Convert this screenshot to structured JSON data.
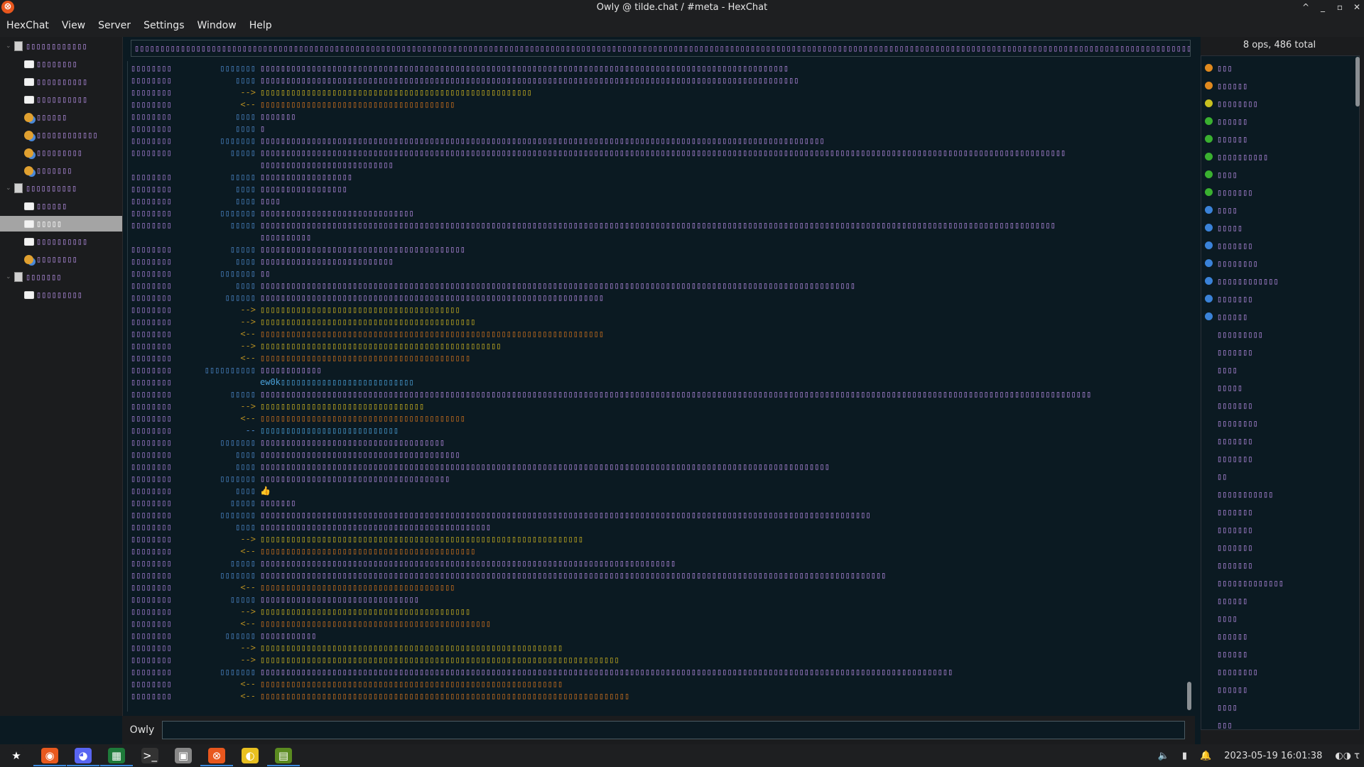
{
  "window": {
    "title": "Owly @ tilde.chat / #meta - HexChat",
    "controls": [
      "^",
      "_",
      "▫",
      "✕"
    ]
  },
  "menu": [
    "HexChat",
    "View",
    "Server",
    "Settings",
    "Window",
    "Help"
  ],
  "tree": [
    {
      "type": "server",
      "label": "▯▯▯▯▯▯▯▯▯▯▯▯"
    },
    {
      "type": "chat",
      "label": "▯▯▯▯▯▯▯▯"
    },
    {
      "type": "chat",
      "label": "▯▯▯▯▯▯▯▯▯▯"
    },
    {
      "type": "chat",
      "label": "▯▯▯▯▯▯▯▯▯▯"
    },
    {
      "type": "users",
      "label": "▯▯▯▯▯▯"
    },
    {
      "type": "users",
      "label": "▯▯▯▯▯▯▯▯▯▯▯▯"
    },
    {
      "type": "users",
      "label": "▯▯▯▯▯▯▯▯▯"
    },
    {
      "type": "users",
      "label": "▯▯▯▯▯▯▯"
    },
    {
      "type": "server",
      "label": "▯▯▯▯▯▯▯▯▯▯"
    },
    {
      "type": "chat",
      "label": "▯▯▯▯▯▯"
    },
    {
      "type": "chat",
      "label": "▯▯▯▯▯",
      "selected": true
    },
    {
      "type": "chat",
      "label": "▯▯▯▯▯▯▯▯▯▯"
    },
    {
      "type": "users",
      "label": "▯▯▯▯▯▯▯▯"
    },
    {
      "type": "server",
      "label": "▯▯▯▯▯▯▯"
    },
    {
      "type": "chat",
      "label": "▯▯▯▯▯▯▯▯▯"
    }
  ],
  "topic": "▯▯▯▯▯▯▯▯▯▯▯▯▯▯▯▯▯▯▯▯▯▯▯▯▯▯▯▯▯▯▯▯▯▯▯▯▯▯▯▯▯▯▯▯▯▯▯▯▯▯▯▯▯▯▯▯▯▯▯▯▯▯▯▯▯▯▯▯▯▯▯▯▯▯▯▯▯▯▯▯▯▯▯▯▯▯▯▯▯▯▯▯▯▯▯▯▯▯▯▯▯▯▯▯▯▯▯▯▯▯▯▯▯▯▯▯▯▯▯▯▯▯▯▯▯▯▯▯▯▯▯▯▯▯▯▯▯▯▯▯▯▯▯▯▯▯▯▯▯▯▯▯▯▯▯▯▯▯▯▯▯▯▯▯▯▯▯▯▯▯▯▯▯▯▯▯▯▯▯▯▯▯▯▯▯▯▯▯▯▯▯▯▯▯▯▯▯▯▯▯▯▯▯▯▯▯▯",
  "chat_lines": [
    {
      "ts": "▯▯▯▯▯▯▯▯",
      "nick": "▯▯▯▯▯▯▯",
      "kind": "msg",
      "text": "▯▯▯▯▯▯▯▯▯▯▯▯▯▯▯▯▯▯▯▯▯▯▯▯▯▯▯▯▯▯▯▯▯▯▯▯▯▯▯▯▯▯▯▯▯▯▯▯▯▯▯▯▯▯▯▯▯▯▯▯▯▯▯▯▯▯▯▯▯▯▯▯▯▯▯▯▯▯▯▯▯▯▯▯▯▯▯▯▯▯▯▯▯▯▯▯▯▯▯▯▯▯▯"
    },
    {
      "ts": "▯▯▯▯▯▯▯▯",
      "nick": "▯▯▯▯",
      "kind": "msg",
      "text": "▯▯▯▯▯▯▯▯▯▯▯▯▯▯▯▯▯▯▯▯▯▯▯▯▯▯▯▯▯▯▯▯▯▯▯▯▯▯▯▯▯▯▯▯▯▯▯▯▯▯▯▯▯▯▯▯▯▯▯▯▯▯▯▯▯▯▯▯▯▯▯▯▯▯▯▯▯▯▯▯▯▯▯▯▯▯▯▯▯▯▯▯▯▯▯▯▯▯▯▯▯▯▯▯▯"
    },
    {
      "ts": "▯▯▯▯▯▯▯▯",
      "nick": "-->",
      "kind": "join",
      "text": "▯▯▯▯▯▯▯▯▯▯▯▯▯▯▯▯▯▯▯▯▯▯▯▯▯▯▯▯▯▯▯▯▯▯▯▯▯▯▯▯▯▯▯▯▯▯▯▯▯▯▯▯▯"
    },
    {
      "ts": "▯▯▯▯▯▯▯▯",
      "nick": "<--",
      "kind": "part",
      "text": "▯▯▯▯▯▯▯▯▯▯▯▯▯▯▯▯▯▯▯▯▯▯▯▯▯▯▯▯▯▯▯▯▯▯▯▯▯▯"
    },
    {
      "ts": "▯▯▯▯▯▯▯▯",
      "nick": "▯▯▯▯",
      "kind": "msg",
      "text": "▯▯▯▯▯▯▯"
    },
    {
      "ts": "▯▯▯▯▯▯▯▯",
      "nick": "▯▯▯▯",
      "kind": "msg",
      "text": "▯"
    },
    {
      "ts": "▯▯▯▯▯▯▯▯",
      "nick": "▯▯▯▯▯▯▯",
      "kind": "msg",
      "text": "▯▯▯▯▯▯▯▯▯▯▯▯▯▯▯▯▯▯▯▯▯▯▯▯▯▯▯▯▯▯▯▯▯▯▯▯▯▯▯▯▯▯▯▯▯▯▯▯▯▯▯▯▯▯▯▯▯▯▯▯▯▯▯▯▯▯▯▯▯▯▯▯▯▯▯▯▯▯▯▯▯▯▯▯▯▯▯▯▯▯▯▯▯▯▯▯▯▯▯▯▯▯▯▯▯▯▯▯▯▯"
    },
    {
      "ts": "▯▯▯▯▯▯▯▯",
      "nick": "▯▯▯▯▯",
      "kind": "msg",
      "text": "▯▯▯▯▯▯▯▯▯▯▯▯▯▯▯▯▯▯▯▯▯▯▯▯▯▯▯▯▯▯▯▯▯▯▯▯▯▯▯▯▯▯▯▯▯▯▯▯▯▯▯▯▯▯▯▯▯▯▯▯▯▯▯▯▯▯▯▯▯▯▯▯▯▯▯▯▯▯▯▯▯▯▯▯▯▯▯▯▯▯▯▯▯▯▯▯▯▯▯▯▯▯▯▯▯▯▯▯▯▯▯▯▯▯▯▯▯▯▯▯▯▯▯▯▯▯▯▯▯▯▯▯▯▯▯▯▯▯▯▯▯▯▯▯▯▯▯▯▯▯▯▯▯▯▯▯▯"
    },
    {
      "ts": "",
      "nick": "",
      "kind": "msg",
      "text": "▯▯▯▯▯▯▯▯▯▯▯▯▯▯▯▯▯▯▯▯▯▯▯▯▯▯"
    },
    {
      "ts": "▯▯▯▯▯▯▯▯",
      "nick": "▯▯▯▯▯",
      "kind": "msg",
      "text": "▯▯▯▯▯▯▯▯▯▯▯▯▯▯▯▯▯▯"
    },
    {
      "ts": "▯▯▯▯▯▯▯▯",
      "nick": "▯▯▯▯",
      "kind": "msg",
      "text": "▯▯▯▯▯▯▯▯▯▯▯▯▯▯▯▯▯"
    },
    {
      "ts": "▯▯▯▯▯▯▯▯",
      "nick": "▯▯▯▯",
      "kind": "msg",
      "text": "▯▯▯▯"
    },
    {
      "ts": "▯▯▯▯▯▯▯▯",
      "nick": "▯▯▯▯▯▯▯",
      "kind": "msg",
      "text": "▯▯▯▯▯▯▯▯▯▯▯▯▯▯▯▯▯▯▯▯▯▯▯▯▯▯▯▯▯▯"
    },
    {
      "ts": "▯▯▯▯▯▯▯▯",
      "nick": "▯▯▯▯▯",
      "kind": "msg",
      "text": "▯▯▯▯▯▯▯▯▯▯▯▯▯▯▯▯▯▯▯▯▯▯▯▯▯▯▯▯▯▯▯▯▯▯▯▯▯▯▯▯▯▯▯▯▯▯▯▯▯▯▯▯▯▯▯▯▯▯▯▯▯▯▯▯▯▯▯▯▯▯▯▯▯▯▯▯▯▯▯▯▯▯▯▯▯▯▯▯▯▯▯▯▯▯▯▯▯▯▯▯▯▯▯▯▯▯▯▯▯▯▯▯▯▯▯▯▯▯▯▯▯▯▯▯▯▯▯▯▯▯▯▯▯▯▯▯▯▯▯▯▯▯▯▯▯▯▯▯▯▯▯▯▯▯▯"
    },
    {
      "ts": "",
      "nick": "",
      "kind": "msg",
      "text": "▯▯▯▯▯▯▯▯▯▯"
    },
    {
      "ts": "▯▯▯▯▯▯▯▯",
      "nick": "▯▯▯▯▯",
      "kind": "msg",
      "text": "▯▯▯▯▯▯▯▯▯▯▯▯▯▯▯▯▯▯▯▯▯▯▯▯▯▯▯▯▯▯▯▯▯▯▯▯▯▯▯▯"
    },
    {
      "ts": "▯▯▯▯▯▯▯▯",
      "nick": "▯▯▯▯",
      "kind": "msg",
      "text": "▯▯▯▯▯▯▯▯▯▯▯▯▯▯▯▯▯▯▯▯▯▯▯▯▯▯"
    },
    {
      "ts": "▯▯▯▯▯▯▯▯",
      "nick": "▯▯▯▯▯▯▯",
      "kind": "msg",
      "text": "▯▯"
    },
    {
      "ts": "▯▯▯▯▯▯▯▯",
      "nick": "▯▯▯▯",
      "kind": "msg",
      "text": "▯▯▯▯▯▯▯▯▯▯▯▯▯▯▯▯▯▯▯▯▯▯▯▯▯▯▯▯▯▯▯▯▯▯▯▯▯▯▯▯▯▯▯▯▯▯▯▯▯▯▯▯▯▯▯▯▯▯▯▯▯▯▯▯▯▯▯▯▯▯▯▯▯▯▯▯▯▯▯▯▯▯▯▯▯▯▯▯▯▯▯▯▯▯▯▯▯▯▯▯▯▯▯▯▯▯▯▯▯▯▯▯▯▯▯▯"
    },
    {
      "ts": "▯▯▯▯▯▯▯▯",
      "nick": "▯▯▯▯▯▯",
      "kind": "msg",
      "text": "▯▯▯▯▯▯▯▯▯▯▯▯▯▯▯▯▯▯▯▯▯▯▯▯▯▯▯▯▯▯▯▯▯▯▯▯▯▯▯▯▯▯▯▯▯▯▯▯▯▯▯▯▯▯▯▯▯▯▯▯▯▯▯▯▯▯▯"
    },
    {
      "ts": "▯▯▯▯▯▯▯▯",
      "nick": "-->",
      "kind": "join",
      "text": "▯▯▯▯▯▯▯▯▯▯▯▯▯▯▯▯▯▯▯▯▯▯▯▯▯▯▯▯▯▯▯▯▯▯▯▯▯▯▯"
    },
    {
      "ts": "▯▯▯▯▯▯▯▯",
      "nick": "-->",
      "kind": "join",
      "text": "▯▯▯▯▯▯▯▯▯▯▯▯▯▯▯▯▯▯▯▯▯▯▯▯▯▯▯▯▯▯▯▯▯▯▯▯▯▯▯▯▯▯"
    },
    {
      "ts": "▯▯▯▯▯▯▯▯",
      "nick": "<--",
      "kind": "part",
      "text": "▯▯▯▯▯▯▯▯▯▯▯▯▯▯▯▯▯▯▯▯▯▯▯▯▯▯▯▯▯▯▯▯▯▯▯▯▯▯▯▯▯▯▯▯▯▯▯▯▯▯▯▯▯▯▯▯▯▯▯▯▯▯▯▯▯▯▯"
    },
    {
      "ts": "▯▯▯▯▯▯▯▯",
      "nick": "-->",
      "kind": "join",
      "text": "▯▯▯▯▯▯▯▯▯▯▯▯▯▯▯▯▯▯▯▯▯▯▯▯▯▯▯▯▯▯▯▯▯▯▯▯▯▯▯▯▯▯▯▯▯▯▯"
    },
    {
      "ts": "▯▯▯▯▯▯▯▯",
      "nick": "<--",
      "kind": "part",
      "text": "▯▯▯▯▯▯▯▯▯▯▯▯▯▯▯▯▯▯▯▯▯▯▯▯▯▯▯▯▯▯▯▯▯▯▯▯▯▯▯▯▯"
    },
    {
      "ts": "▯▯▯▯▯▯▯▯",
      "nick": "▯▯▯▯▯▯▯▯▯▯",
      "kind": "msg",
      "text": "▯▯▯▯▯▯▯▯▯▯▯▯"
    },
    {
      "ts": "▯▯▯▯▯▯▯▯",
      "nick": "",
      "kind": "mention",
      "text": "ew0k▯▯▯▯▯▯▯▯▯▯▯▯▯▯▯▯▯▯▯▯▯▯▯▯▯▯"
    },
    {
      "ts": "▯▯▯▯▯▯▯▯",
      "nick": "▯▯▯▯▯",
      "kind": "msg",
      "text": "▯▯▯▯▯▯▯▯▯▯▯▯▯▯▯▯▯▯▯▯▯▯▯▯▯▯▯▯▯▯▯▯▯▯▯▯▯▯▯▯▯▯▯▯▯▯▯▯▯▯▯▯▯▯▯▯▯▯▯▯▯▯▯▯▯▯▯▯▯▯▯▯▯▯▯▯▯▯▯▯▯▯▯▯▯▯▯▯▯▯▯▯▯▯▯▯▯▯▯▯▯▯▯▯▯▯▯▯▯▯▯▯▯▯▯▯▯▯▯▯▯▯▯▯▯▯▯▯▯▯▯▯▯▯▯▯▯▯▯▯▯▯▯▯▯▯▯▯▯▯▯▯▯▯▯▯▯▯▯▯▯▯"
    },
    {
      "ts": "▯▯▯▯▯▯▯▯",
      "nick": "-->",
      "kind": "join",
      "text": "▯▯▯▯▯▯▯▯▯▯▯▯▯▯▯▯▯▯▯▯▯▯▯▯▯▯▯▯▯▯▯▯"
    },
    {
      "ts": "▯▯▯▯▯▯▯▯",
      "nick": "<--",
      "kind": "part",
      "text": "▯▯▯▯▯▯▯▯▯▯▯▯▯▯▯▯▯▯▯▯▯▯▯▯▯▯▯▯▯▯▯▯▯▯▯▯▯▯▯▯"
    },
    {
      "ts": "▯▯▯▯▯▯▯▯",
      "nick": "--",
      "kind": "mention",
      "text": "▯▯▯▯▯▯▯▯▯▯▯▯▯▯▯▯▯▯▯▯▯▯▯▯▯▯▯"
    },
    {
      "ts": "▯▯▯▯▯▯▯▯",
      "nick": "▯▯▯▯▯▯▯",
      "kind": "msg",
      "text": "▯▯▯▯▯▯▯▯▯▯▯▯▯▯▯▯▯▯▯▯▯▯▯▯▯▯▯▯▯▯▯▯▯▯▯▯"
    },
    {
      "ts": "▯▯▯▯▯▯▯▯",
      "nick": "▯▯▯▯",
      "kind": "msg",
      "text": "▯▯▯▯▯▯▯▯▯▯▯▯▯▯▯▯▯▯▯▯▯▯▯▯▯▯▯▯▯▯▯▯▯▯▯▯▯▯▯"
    },
    {
      "ts": "▯▯▯▯▯▯▯▯",
      "nick": "▯▯▯▯",
      "kind": "msg",
      "text": "▯▯▯▯▯▯▯▯▯▯▯▯▯▯▯▯▯▯▯▯▯▯▯▯▯▯▯▯▯▯▯▯▯▯▯▯▯▯▯▯▯▯▯▯▯▯▯▯▯▯▯▯▯▯▯▯▯▯▯▯▯▯▯▯▯▯▯▯▯▯▯▯▯▯▯▯▯▯▯▯▯▯▯▯▯▯▯▯▯▯▯▯▯▯▯▯▯▯▯▯▯▯▯▯▯▯▯▯▯▯▯"
    },
    {
      "ts": "▯▯▯▯▯▯▯▯",
      "nick": "▯▯▯▯▯▯▯",
      "kind": "msg",
      "text": "▯▯▯▯▯▯▯▯▯▯▯▯▯▯▯▯▯▯▯▯▯▯▯▯▯▯▯▯▯▯▯▯▯▯▯▯▯"
    },
    {
      "ts": "▯▯▯▯▯▯▯▯",
      "nick": "▯▯▯▯",
      "kind": "msg",
      "text": "👍"
    },
    {
      "ts": "▯▯▯▯▯▯▯▯",
      "nick": "▯▯▯▯▯",
      "kind": "msg",
      "text": "▯▯▯▯▯▯▯"
    },
    {
      "ts": "▯▯▯▯▯▯▯▯",
      "nick": "▯▯▯▯▯▯▯",
      "kind": "msg",
      "text": "▯▯▯▯▯▯▯▯▯▯▯▯▯▯▯▯▯▯▯▯▯▯▯▯▯▯▯▯▯▯▯▯▯▯▯▯▯▯▯▯▯▯▯▯▯▯▯▯▯▯▯▯▯▯▯▯▯▯▯▯▯▯▯▯▯▯▯▯▯▯▯▯▯▯▯▯▯▯▯▯▯▯▯▯▯▯▯▯▯▯▯▯▯▯▯▯▯▯▯▯▯▯▯▯▯▯▯▯▯▯▯▯▯▯▯▯▯▯▯"
    },
    {
      "ts": "▯▯▯▯▯▯▯▯",
      "nick": "▯▯▯▯",
      "kind": "msg",
      "text": "▯▯▯▯▯▯▯▯▯▯▯▯▯▯▯▯▯▯▯▯▯▯▯▯▯▯▯▯▯▯▯▯▯▯▯▯▯▯▯▯▯▯▯▯▯"
    },
    {
      "ts": "▯▯▯▯▯▯▯▯",
      "nick": "-->",
      "kind": "join",
      "text": "▯▯▯▯▯▯▯▯▯▯▯▯▯▯▯▯▯▯▯▯▯▯▯▯▯▯▯▯▯▯▯▯▯▯▯▯▯▯▯▯▯▯▯▯▯▯▯▯▯▯▯▯▯▯▯▯▯▯▯▯▯▯▯"
    },
    {
      "ts": "▯▯▯▯▯▯▯▯",
      "nick": "<--",
      "kind": "part",
      "text": "▯▯▯▯▯▯▯▯▯▯▯▯▯▯▯▯▯▯▯▯▯▯▯▯▯▯▯▯▯▯▯▯▯▯▯▯▯▯▯▯▯▯"
    },
    {
      "ts": "▯▯▯▯▯▯▯▯",
      "nick": "▯▯▯▯▯",
      "kind": "msg",
      "text": "▯▯▯▯▯▯▯▯▯▯▯▯▯▯▯▯▯▯▯▯▯▯▯▯▯▯▯▯▯▯▯▯▯▯▯▯▯▯▯▯▯▯▯▯▯▯▯▯▯▯▯▯▯▯▯▯▯▯▯▯▯▯▯▯▯▯▯▯▯▯▯▯▯▯▯▯▯▯▯▯▯"
    },
    {
      "ts": "▯▯▯▯▯▯▯▯",
      "nick": "▯▯▯▯▯▯▯",
      "kind": "msg",
      "text": "▯▯▯▯▯▯▯▯▯▯▯▯▯▯▯▯▯▯▯▯▯▯▯▯▯▯▯▯▯▯▯▯▯▯▯▯▯▯▯▯▯▯▯▯▯▯▯▯▯▯▯▯▯▯▯▯▯▯▯▯▯▯▯▯▯▯▯▯▯▯▯▯▯▯▯▯▯▯▯▯▯▯▯▯▯▯▯▯▯▯▯▯▯▯▯▯▯▯▯▯▯▯▯▯▯▯▯▯▯▯▯▯▯▯▯▯▯▯▯▯▯▯"
    },
    {
      "ts": "▯▯▯▯▯▯▯▯",
      "nick": "<--",
      "kind": "part",
      "text": "▯▯▯▯▯▯▯▯▯▯▯▯▯▯▯▯▯▯▯▯▯▯▯▯▯▯▯▯▯▯▯▯▯▯▯▯▯▯"
    },
    {
      "ts": "▯▯▯▯▯▯▯▯",
      "nick": "▯▯▯▯▯",
      "kind": "msg",
      "text": "▯▯▯▯▯▯▯▯▯▯▯▯▯▯▯▯▯▯▯▯▯▯▯▯▯▯▯▯▯▯▯"
    },
    {
      "ts": "▯▯▯▯▯▯▯▯",
      "nick": "-->",
      "kind": "join",
      "text": "▯▯▯▯▯▯▯▯▯▯▯▯▯▯▯▯▯▯▯▯▯▯▯▯▯▯▯▯▯▯▯▯▯▯▯▯▯▯▯▯▯"
    },
    {
      "ts": "▯▯▯▯▯▯▯▯",
      "nick": "<--",
      "kind": "part",
      "text": "▯▯▯▯▯▯▯▯▯▯▯▯▯▯▯▯▯▯▯▯▯▯▯▯▯▯▯▯▯▯▯▯▯▯▯▯▯▯▯▯▯▯▯▯▯"
    },
    {
      "ts": "▯▯▯▯▯▯▯▯",
      "nick": "▯▯▯▯▯▯",
      "kind": "msg",
      "text": "▯▯▯▯▯▯▯▯▯▯▯"
    },
    {
      "ts": "▯▯▯▯▯▯▯▯",
      "nick": "-->",
      "kind": "join",
      "text": "▯▯▯▯▯▯▯▯▯▯▯▯▯▯▯▯▯▯▯▯▯▯▯▯▯▯▯▯▯▯▯▯▯▯▯▯▯▯▯▯▯▯▯▯▯▯▯▯▯▯▯▯▯▯▯▯▯▯▯"
    },
    {
      "ts": "▯▯▯▯▯▯▯▯",
      "nick": "-->",
      "kind": "join",
      "text": "▯▯▯▯▯▯▯▯▯▯▯▯▯▯▯▯▯▯▯▯▯▯▯▯▯▯▯▯▯▯▯▯▯▯▯▯▯▯▯▯▯▯▯▯▯▯▯▯▯▯▯▯▯▯▯▯▯▯▯▯▯▯▯▯▯▯▯▯▯▯"
    },
    {
      "ts": "▯▯▯▯▯▯▯▯",
      "nick": "▯▯▯▯▯▯▯",
      "kind": "msg",
      "text": "▯▯▯▯▯▯▯▯▯▯▯▯▯▯▯▯▯▯▯▯▯▯▯▯▯▯▯▯▯▯▯▯▯▯▯▯▯▯▯▯▯▯▯▯▯▯▯▯▯▯▯▯▯▯▯▯▯▯▯▯▯▯▯▯▯▯▯▯▯▯▯▯▯▯▯▯▯▯▯▯▯▯▯▯▯▯▯▯▯▯▯▯▯▯▯▯▯▯▯▯▯▯▯▯▯▯▯▯▯▯▯▯▯▯▯▯▯▯▯▯▯▯▯▯▯▯▯▯▯▯▯▯▯▯▯"
    },
    {
      "ts": "▯▯▯▯▯▯▯▯",
      "nick": "<--",
      "kind": "part",
      "text": "▯▯▯▯▯▯▯▯▯▯▯▯▯▯▯▯▯▯▯▯▯▯▯▯▯▯▯▯▯▯▯▯▯▯▯▯▯▯▯▯▯▯▯▯▯▯▯▯▯▯▯▯▯▯▯▯▯▯▯"
    },
    {
      "ts": "▯▯▯▯▯▯▯▯",
      "nick": "<--",
      "kind": "part",
      "text": "▯▯▯▯▯▯▯▯▯▯▯▯▯▯▯▯▯▯▯▯▯▯▯▯▯▯▯▯▯▯▯▯▯▯▯▯▯▯▯▯▯▯▯▯▯▯▯▯▯▯▯▯▯▯▯▯▯▯▯▯▯▯▯▯▯▯▯▯▯▯▯▯"
    }
  ],
  "input": {
    "nick": "Owly",
    "value": ""
  },
  "userlist": {
    "header": "8 ops, 486 total",
    "users": [
      {
        "status": "orange",
        "name": "▯▯▯"
      },
      {
        "status": "orange",
        "name": "▯▯▯▯▯▯"
      },
      {
        "status": "yellow",
        "name": "▯▯▯▯▯▯▯▯"
      },
      {
        "status": "green",
        "name": "▯▯▯▯▯▯"
      },
      {
        "status": "green",
        "name": "▯▯▯▯▯▯"
      },
      {
        "status": "green",
        "name": "▯▯▯▯▯▯▯▯▯▯"
      },
      {
        "status": "green",
        "name": "▯▯▯▯"
      },
      {
        "status": "green",
        "name": "▯▯▯▯▯▯▯"
      },
      {
        "status": "blue",
        "name": "▯▯▯▯"
      },
      {
        "status": "blue",
        "name": "▯▯▯▯▯"
      },
      {
        "status": "blue",
        "name": "▯▯▯▯▯▯▯"
      },
      {
        "status": "blue",
        "name": "▯▯▯▯▯▯▯▯"
      },
      {
        "status": "blue",
        "name": "▯▯▯▯▯▯▯▯▯▯▯▯"
      },
      {
        "status": "blue",
        "name": "▯▯▯▯▯▯▯"
      },
      {
        "status": "blue",
        "name": "▯▯▯▯▯▯"
      },
      {
        "status": "none",
        "name": "▯▯▯▯▯▯▯▯▯"
      },
      {
        "status": "none",
        "name": "▯▯▯▯▯▯▯"
      },
      {
        "status": "none",
        "name": "▯▯▯▯"
      },
      {
        "status": "none",
        "name": "▯▯▯▯▯"
      },
      {
        "status": "none",
        "name": "▯▯▯▯▯▯▯"
      },
      {
        "status": "none",
        "name": "▯▯▯▯▯▯▯▯"
      },
      {
        "status": "none",
        "name": "▯▯▯▯▯▯▯"
      },
      {
        "status": "none",
        "name": "▯▯▯▯▯▯▯"
      },
      {
        "status": "none",
        "name": "▯▯"
      },
      {
        "status": "none",
        "name": "▯▯▯▯▯▯▯▯▯▯▯"
      },
      {
        "status": "none",
        "name": "▯▯▯▯▯▯▯"
      },
      {
        "status": "none",
        "name": "▯▯▯▯▯▯▯"
      },
      {
        "status": "none",
        "name": "▯▯▯▯▯▯▯"
      },
      {
        "status": "none",
        "name": "▯▯▯▯▯▯▯"
      },
      {
        "status": "none",
        "name": "▯▯▯▯▯▯▯▯▯▯▯▯▯"
      },
      {
        "status": "none",
        "name": "▯▯▯▯▯▯"
      },
      {
        "status": "none",
        "name": "▯▯▯▯"
      },
      {
        "status": "none",
        "name": "▯▯▯▯▯▯"
      },
      {
        "status": "none",
        "name": "▯▯▯▯▯▯"
      },
      {
        "status": "none",
        "name": "▯▯▯▯▯▯▯▯"
      },
      {
        "status": "none",
        "name": "▯▯▯▯▯▯"
      },
      {
        "status": "none",
        "name": "▯▯▯▯"
      },
      {
        "status": "none",
        "name": "▯▯▯"
      }
    ]
  },
  "status_colors": {
    "orange": "#e0891e",
    "yellow": "#c8c020",
    "green": "#3ab030",
    "blue": "#3a82d8"
  },
  "taskbar": {
    "apps": [
      {
        "name": "menu-star-icon",
        "glyph": "★",
        "bg": "#1e1f21"
      },
      {
        "name": "firefox-icon",
        "glyph": "◉",
        "bg": "#e8591e",
        "active": true
      },
      {
        "name": "discord-icon",
        "glyph": "◕",
        "bg": "#5865f2",
        "active": true
      },
      {
        "name": "spreadsheet-icon",
        "glyph": "▦",
        "bg": "#1e7a3a",
        "active": true
      },
      {
        "name": "terminal-icon",
        "glyph": ">_",
        "bg": "#333"
      },
      {
        "name": "files-icon",
        "glyph": "▣",
        "bg": "#888"
      },
      {
        "name": "hexchat-icon",
        "glyph": "⊗",
        "bg": "#e8571e",
        "active": true
      },
      {
        "name": "palette-icon",
        "glyph": "◐",
        "bg": "#e8c020"
      },
      {
        "name": "monitor-icon",
        "glyph": "▤",
        "bg": "#5a8a20",
        "active": true
      }
    ],
    "tray": {
      "volume": "🔈",
      "battery": "▮",
      "bell": "🔔",
      "clock": "2023-05-19 16:01:38",
      "extra": "◐◑ τ"
    }
  }
}
